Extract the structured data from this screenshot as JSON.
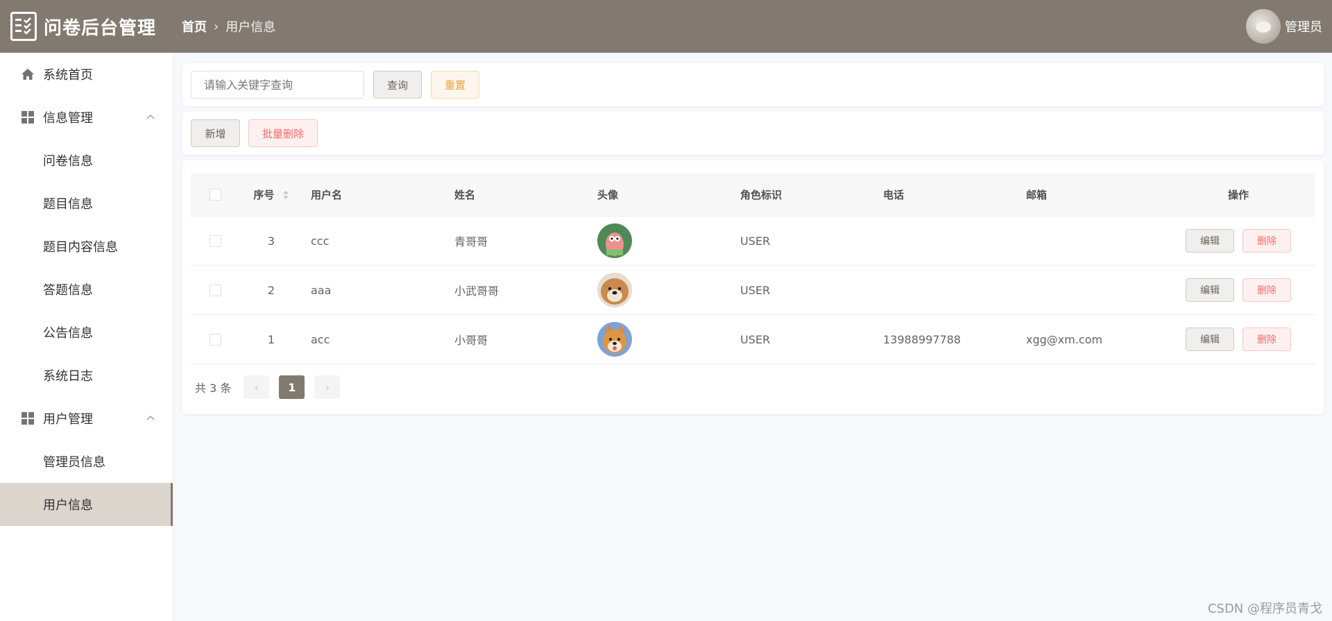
{
  "app": {
    "title": "问卷后台管理"
  },
  "breadcrumb": {
    "home": "首页",
    "separator": "›",
    "current": "用户信息"
  },
  "header": {
    "admin_label": "管理员"
  },
  "sidebar": {
    "items": [
      {
        "label": "系统首页"
      },
      {
        "label": "信息管理"
      },
      {
        "label": "问卷信息"
      },
      {
        "label": "题目信息"
      },
      {
        "label": "题目内容信息"
      },
      {
        "label": "答题信息"
      },
      {
        "label": "公告信息"
      },
      {
        "label": "系统日志"
      },
      {
        "label": "用户管理"
      },
      {
        "label": "管理员信息"
      },
      {
        "label": "用户信息"
      }
    ]
  },
  "search": {
    "placeholder": "请输入关键字查询",
    "query_label": "查询",
    "reset_label": "重置"
  },
  "toolbar": {
    "add_label": "新增",
    "batch_delete_label": "批量删除"
  },
  "table": {
    "headers": {
      "id": "序号",
      "username": "用户名",
      "name": "姓名",
      "avatar": "头像",
      "role": "角色标识",
      "phone": "电话",
      "email": "邮箱",
      "ops": "操作"
    },
    "rows": [
      {
        "id": "3",
        "username": "ccc",
        "name": "青哥哥",
        "role": "USER",
        "phone": "",
        "email": ""
      },
      {
        "id": "2",
        "username": "aaa",
        "name": "小武哥哥",
        "role": "USER",
        "phone": "",
        "email": ""
      },
      {
        "id": "1",
        "username": "acc",
        "name": "小哥哥",
        "role": "USER",
        "phone": "13988997788",
        "email": "xgg@xm.com"
      }
    ],
    "edit_label": "编辑",
    "delete_label": "删除"
  },
  "pagination": {
    "total_text": "共 3 条",
    "current_page": "1",
    "prev": "‹",
    "next": "›"
  },
  "watermark": "CSDN @程序员青戈",
  "colors": {
    "header_bg": "#827a70",
    "active_menu_bg": "#dcd5cd",
    "primary": "#827a70",
    "danger": "#f56c6c",
    "warning": "#e6a23c"
  }
}
